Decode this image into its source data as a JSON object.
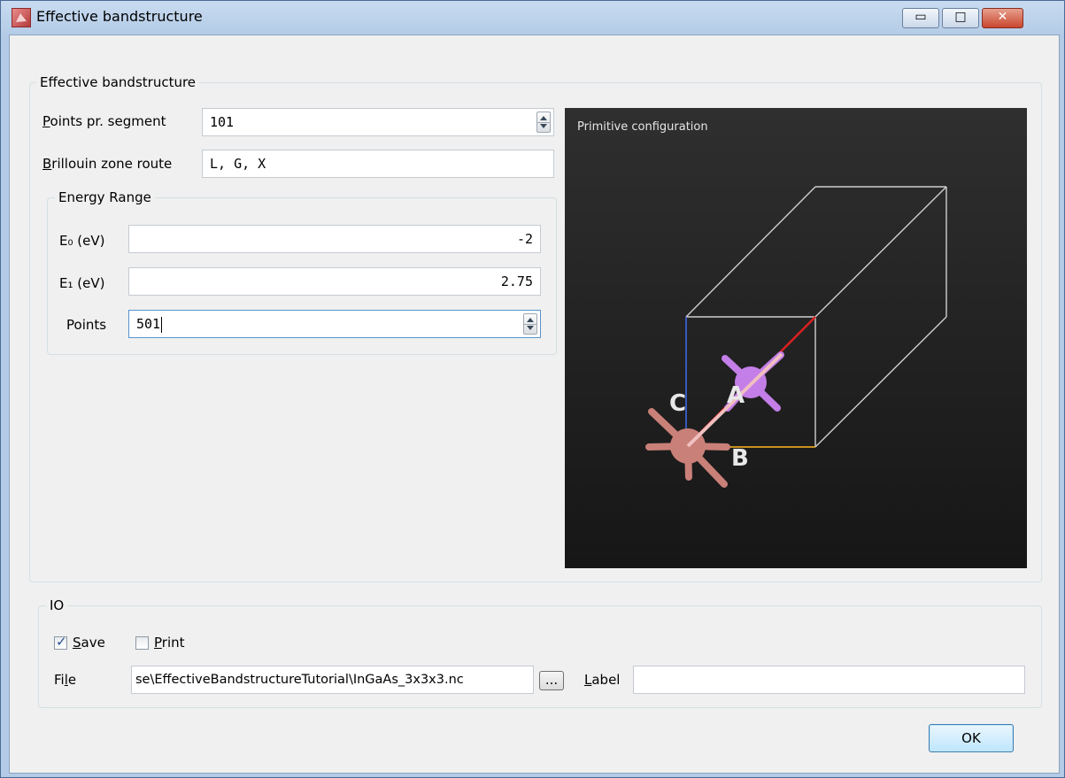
{
  "window": {
    "title": "Effective bandstructure",
    "minimize_glyph": "▭",
    "maximize_glyph": "□",
    "close_glyph": "✕"
  },
  "main_group": {
    "legend": "Effective bandstructure",
    "points_pr_segment": {
      "label_first": "P",
      "label_rest": "oints pr. segment",
      "value": "101"
    },
    "brillouin_zone_route": {
      "label_first": "B",
      "label_rest": "rillouin zone route",
      "value": "L, G, X"
    },
    "energy_range": {
      "legend": "Energy Range",
      "e0_label": "E₀ (eV)",
      "e0_value": "-2",
      "e1_label": "E₁ (eV)",
      "e1_value": "2.75",
      "points_label": "Points",
      "points_value": "501"
    },
    "viewer": {
      "label": "Primitive configuration",
      "axis_a": "A",
      "axis_b": "B",
      "axis_c": "C",
      "colors": {
        "axis_a": "#d62020",
        "axis_b": "#e0a020",
        "axis_c": "#3a5fcd",
        "atom_a": "#c47ee8",
        "atom_b": "#c98078"
      }
    }
  },
  "io_group": {
    "legend": "IO",
    "save": {
      "label_first": "S",
      "label_rest": "ave",
      "checked": true
    },
    "print": {
      "label_first": "P",
      "label_rest": "rint",
      "checked": false
    },
    "file": {
      "label_first": "Fi",
      "label_u": "l",
      "label_rest": "e",
      "value": "se\\EffectiveBandstructureTutorial\\InGaAs_3x3x3.nc",
      "browse_label": "..."
    },
    "label_field": {
      "label_first": "L",
      "label_rest": "abel",
      "value": ""
    }
  },
  "buttons": {
    "ok": "OK"
  }
}
